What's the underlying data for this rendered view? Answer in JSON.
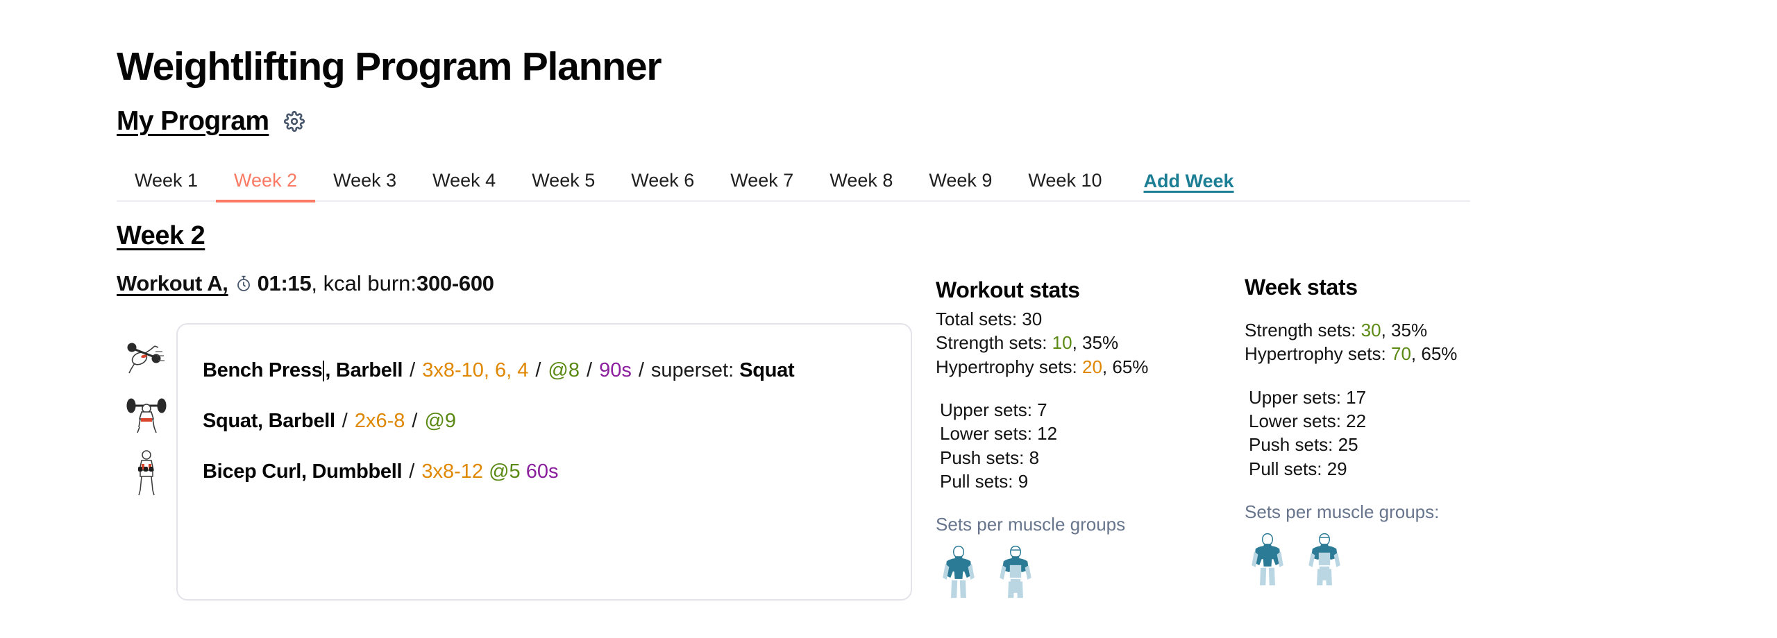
{
  "header": {
    "app_title": "Weightlifting Program Planner",
    "program_name": "My Program",
    "settings_icon": "gear-icon"
  },
  "tabs": {
    "items": [
      {
        "label": "Week 1",
        "active": false
      },
      {
        "label": "Week 2",
        "active": true
      },
      {
        "label": "Week 3",
        "active": false
      },
      {
        "label": "Week 4",
        "active": false
      },
      {
        "label": "Week 5",
        "active": false
      },
      {
        "label": "Week 6",
        "active": false
      },
      {
        "label": "Week 7",
        "active": false
      },
      {
        "label": "Week 8",
        "active": false
      },
      {
        "label": "Week 9",
        "active": false
      },
      {
        "label": "Week 10",
        "active": false
      }
    ],
    "add_week": "Add Week",
    "active_color": "#fa7a63",
    "add_week_color": "#1b7e94"
  },
  "week": {
    "title": "Week 2"
  },
  "workout": {
    "name": "Workout A,",
    "timer_icon": "stopwatch-icon",
    "duration": "01:15",
    "kcal_label": ", kcal burn: ",
    "kcal_value": "300-600"
  },
  "exercises": [
    {
      "thumb_icon": "bench-press-icon",
      "name": "Bench Press",
      "name_tail": ", Barbell",
      "reps": "3x8-10, 6, 4",
      "rpe": "@8",
      "rest": "90s",
      "superset_label": "superset:",
      "superset_value": "Squat",
      "has_caret": true
    },
    {
      "thumb_icon": "squat-icon",
      "name": "Squat, Barbell",
      "reps": "2x6-8",
      "rpe": "@9",
      "rest": "",
      "superset_label": "",
      "superset_value": "",
      "has_caret": false
    },
    {
      "thumb_icon": "bicep-curl-icon",
      "name": "Bicep Curl, Dumbbell",
      "reps": "3x8-12",
      "rpe": "@5",
      "rest": "60s",
      "superset_label": "",
      "superset_value": "",
      "has_caret": false
    }
  ],
  "colors": {
    "reps": "#e08700",
    "rpe": "#5b8a14",
    "rest": "#8b1f9e",
    "muted": "#68768d",
    "body_dark": "#2b7a96",
    "body_light": "#b9d6e2"
  },
  "workout_stats": {
    "title": "Workout stats",
    "total_sets": "Total sets: 30",
    "strength_prefix": "Strength sets: ",
    "strength_value": "10",
    "strength_suffix": ", 35%",
    "hypertrophy_prefix": "Hypertrophy sets: ",
    "hypertrophy_value": "20",
    "hypertrophy_suffix": ", 65%",
    "upper": "Upper sets: 7",
    "lower": "Lower sets: 12",
    "push": "Push sets: 8",
    "pull": "Pull sets: 9",
    "muscle_label": "Sets per muscle groups"
  },
  "week_stats": {
    "title": "Week stats",
    "strength_prefix": "Strength sets: ",
    "strength_value": "30",
    "strength_suffix": ", 35%",
    "hypertrophy_prefix": "Hypertrophy sets: ",
    "hypertrophy_value": "70",
    "hypertrophy_suffix": ", 65%",
    "upper": "Upper sets: 17",
    "lower": "Lower sets: 22",
    "push": "Push sets: 25",
    "pull": "Pull sets: 29",
    "muscle_label": "Sets per muscle groups:"
  }
}
